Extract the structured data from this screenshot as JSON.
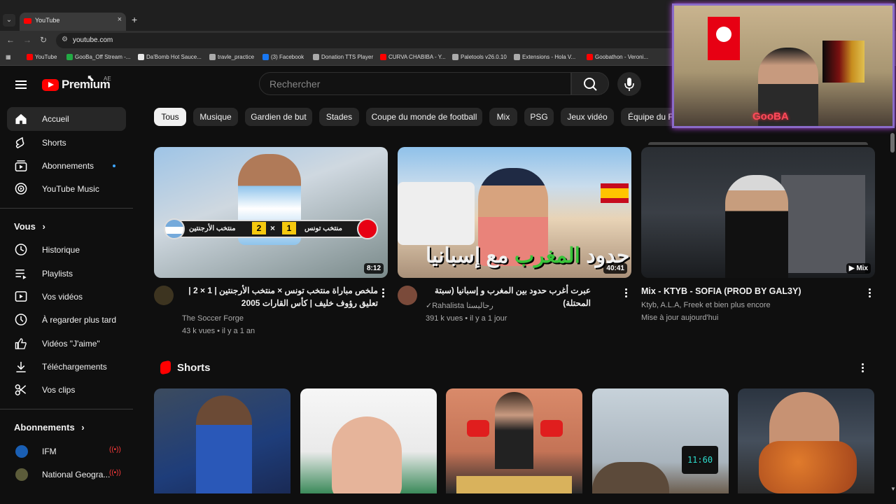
{
  "browser": {
    "tab_title": "YouTube",
    "url": "youtube.com",
    "bookmarks": [
      {
        "label": "YouTube",
        "color": "#ff0000"
      },
      {
        "label": "GooBa_Off Stream -...",
        "color": "#22aa44"
      },
      {
        "label": "Da'Bomb Hot Sauce...",
        "color": "#e8e8e8"
      },
      {
        "label": "travle_practice",
        "color": "#aaaaaa"
      },
      {
        "label": "(3) Facebook",
        "color": "#1877f2"
      },
      {
        "label": "Donation TTS Player",
        "color": "#aaaaaa"
      },
      {
        "label": "CURVA CHABIBA - Y...",
        "color": "#ff0000"
      },
      {
        "label": "Paletools v26.0.10",
        "color": "#aaaaaa"
      },
      {
        "label": "Extensions - Hola V...",
        "color": "#aaaaaa"
      },
      {
        "label": "Goobathon - Veroni...",
        "color": "#ff0000"
      }
    ]
  },
  "header": {
    "logo_text": "Premium",
    "region": "AE",
    "search_placeholder": "Rechercher"
  },
  "sidebar": {
    "main": [
      {
        "label": "Accueil",
        "icon": "home-icon"
      },
      {
        "label": "Shorts",
        "icon": "shorts-icon"
      },
      {
        "label": "Abonnements",
        "icon": "subscriptions-icon"
      },
      {
        "label": "YouTube Music",
        "icon": "music-icon"
      }
    ],
    "you_heading": "Vous",
    "you": [
      {
        "label": "Historique",
        "icon": "history-icon"
      },
      {
        "label": "Playlists",
        "icon": "playlists-icon"
      },
      {
        "label": "Vos vidéos",
        "icon": "your-videos-icon"
      },
      {
        "label": "À regarder plus tard",
        "icon": "watch-later-icon"
      },
      {
        "label": "Vidéos \"J'aime\"",
        "icon": "like-icon"
      },
      {
        "label": "Téléchargements",
        "icon": "download-icon"
      },
      {
        "label": "Vos clips",
        "icon": "clips-icon"
      }
    ],
    "subs_heading": "Abonnements",
    "subs": [
      {
        "label": "IFM"
      },
      {
        "label": "National Geogra..."
      }
    ]
  },
  "chips": [
    "Tous",
    "Musique",
    "Gardien de but",
    "Stades",
    "Coupe du monde de football",
    "Mix",
    "PSG",
    "Jeux vidéo",
    "Équipe du F"
  ],
  "videos": [
    {
      "title": "ملخص مباراة منتخب تونس × منتخب الأرجنتين | 1 × 2 | تعليق رؤوف خليف | كأس القارات 2005",
      "channel": "The Soccer Forge",
      "meta": "43 k vues • il y a 1 an",
      "duration": "8:12",
      "thumb_left_team": "منتخب الأرجنتين",
      "thumb_right_team": "منتخب تونس",
      "score_left": "2",
      "score_right": "1",
      "score_sep": "×"
    },
    {
      "title": "عبرت أغرب حدود بين المغرب و إسبانيا (سبتة المحتلة)",
      "channel": "Rahalista رحاليستا",
      "meta": "391 k vues • il y a 1 jour",
      "duration": "40:41",
      "thumb_caption_a": "حدود ",
      "thumb_caption_b": "المغرب",
      "thumb_caption_c": " مع إسبانيا"
    },
    {
      "title": "Mix - KTYB - SOFIA (PROD BY GAL3Y)",
      "channel": "Ktyb, A.L.A, Freek et bien plus encore",
      "meta": "Mise à jour aujourd'hui",
      "duration": "Mix"
    }
  ],
  "shorts": {
    "heading": "Shorts",
    "clock_readout": "11:60"
  },
  "overlay": {
    "streamer_tag": "GooBA"
  }
}
